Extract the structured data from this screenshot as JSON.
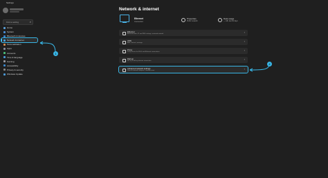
{
  "window": {
    "title": "Settings"
  },
  "search": {
    "placeholder": "Find a setting"
  },
  "sidebar": {
    "items": [
      {
        "label": "Home",
        "color": "#5aa0d8"
      },
      {
        "label": "System",
        "color": "#4a90d9"
      },
      {
        "label": "Bluetooth & devices",
        "color": "#3a82d0"
      },
      {
        "label": "Network & internet",
        "color": "#4aa5e0"
      },
      {
        "label": "Personalization",
        "color": "#d98a4a"
      },
      {
        "label": "Apps",
        "color": "#8a8fa0"
      },
      {
        "label": "Accounts",
        "color": "#4ac07a"
      },
      {
        "label": "Time & language",
        "color": "#4a9ad9"
      },
      {
        "label": "Gaming",
        "color": "#9a9aa0"
      },
      {
        "label": "Accessibility",
        "color": "#3a8ad0"
      },
      {
        "label": "Privacy & security",
        "color": "#8a8a8a"
      },
      {
        "label": "Windows Update",
        "color": "#4a9ad9"
      }
    ],
    "selected_index": 3
  },
  "main": {
    "title": "Network & internet",
    "status": {
      "name": "Ethernet",
      "status_text": "Connected",
      "properties_label": "Properties",
      "properties_sub": "Public network",
      "data_usage_label": "Data usage",
      "data_usage_sub": "— GB, last 30 days"
    },
    "cards": [
      {
        "title": "Ethernet",
        "subtitle": "Authentication, IP and DNS settings, metered network",
        "icon": "ethernet-icon"
      },
      {
        "title": "VPN",
        "subtitle": "Add, connect, manage",
        "icon": "shield-icon"
      },
      {
        "title": "Proxy",
        "subtitle": "Proxy server for Wi-Fi and Ethernet connections",
        "icon": "proxy-icon"
      },
      {
        "title": "Dial-up",
        "subtitle": "Set up a dial-up internet connection",
        "icon": "phone-icon"
      },
      {
        "title": "Advanced network settings",
        "subtitle": "View all network adapters, network reset",
        "icon": "network-settings-icon"
      }
    ]
  },
  "annotations": [
    {
      "label": "1"
    },
    {
      "label": "2"
    }
  ],
  "colors": {
    "accent": "#39b6e6",
    "background": "#1f1f1f",
    "card": "#2b2b2b"
  }
}
